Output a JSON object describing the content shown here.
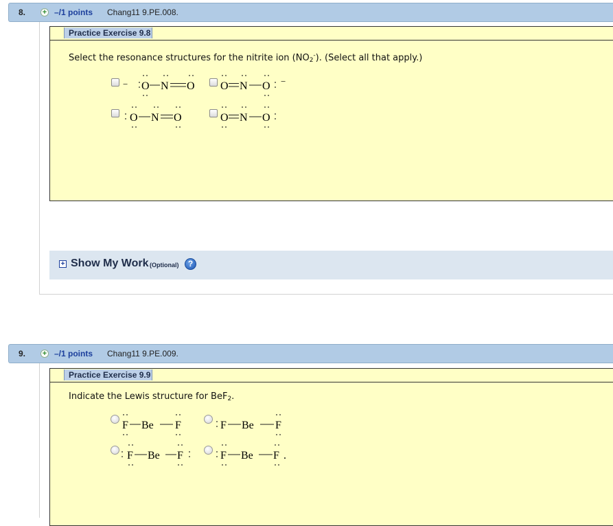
{
  "questions": [
    {
      "number": "8.",
      "points": "–/1 points",
      "code": "Chang11 9.PE.008.",
      "exercise_title": "Practice Exercise 9.8",
      "prompt_before": "Select the resonance structures for the nitrite ion (NO",
      "prompt_sub": "2",
      "prompt_sup": "-",
      "prompt_after": "). (Select all that apply.)",
      "input_type": "checkbox",
      "options": [
        {
          "atoms": [
            "O",
            "N",
            "O"
          ],
          "charge_left": "−",
          "charge_right": ""
        },
        {
          "atoms": [
            "O",
            "N",
            "O"
          ],
          "charge_left": "",
          "charge_right": "−"
        },
        {
          "atoms": [
            "O",
            "N",
            "O"
          ],
          "charge_left": "",
          "charge_right": ""
        },
        {
          "atoms": [
            "O",
            "N",
            "O"
          ],
          "charge_left": "",
          "charge_right": ""
        }
      ]
    },
    {
      "number": "9.",
      "points": "–/1 points",
      "code": "Chang11 9.PE.009.",
      "exercise_title": "Practice Exercise 9.9",
      "prompt_before": "Indicate the Lewis structure for BeF",
      "prompt_sub": "2",
      "prompt_after": ".",
      "input_type": "radio",
      "options": [
        {
          "atoms": [
            "F",
            "Be",
            "F"
          ],
          "charge_right": ""
        },
        {
          "atoms": [
            "F",
            "Be",
            "F"
          ],
          "charge_right": ""
        },
        {
          "atoms": [
            "F",
            "Be",
            "F"
          ],
          "charge_right": ""
        },
        {
          "atoms": [
            "F",
            "Be",
            "F"
          ],
          "charge_right": "."
        }
      ]
    }
  ],
  "show_my_work": {
    "label": "Show My Work",
    "optional": "(Optional)",
    "toggle_icon": "plus-box-icon",
    "help_icon": "question-circle-icon"
  },
  "colors": {
    "header_bg": "#b1cbe5",
    "exercise_bg": "#ffffc6",
    "points_text": "#1c3f9c",
    "show_work_bg": "#dce6f0"
  }
}
